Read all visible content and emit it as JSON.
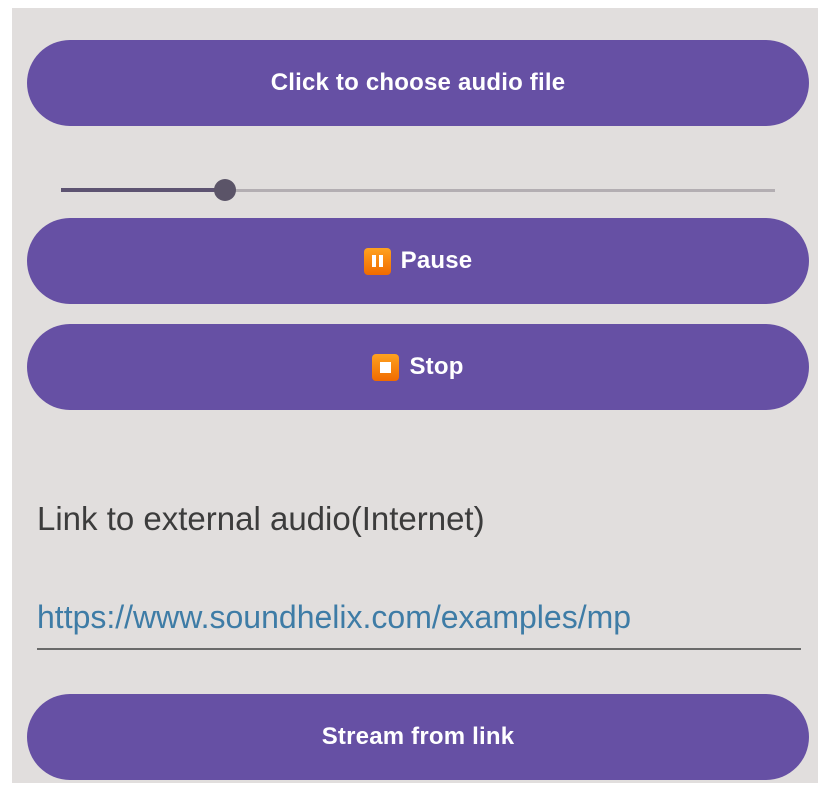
{
  "buttons": {
    "choose_file_label": "Click to choose audio file",
    "pause_label": "Pause",
    "stop_label": "Stop",
    "stream_label": "Stream from link"
  },
  "icons": {
    "pause": "pause-icon",
    "stop": "stop-icon"
  },
  "seekbar": {
    "progress_fraction": 0.23
  },
  "link_section": {
    "label": "Link to external audio(Internet)",
    "url_value": "https://www.soundhelix.com/examples/mp"
  },
  "colors": {
    "accent": "#6650a4",
    "background": "#e1dedd",
    "icon_orange": "#f7820c",
    "link_text": "#3e7ca6"
  }
}
